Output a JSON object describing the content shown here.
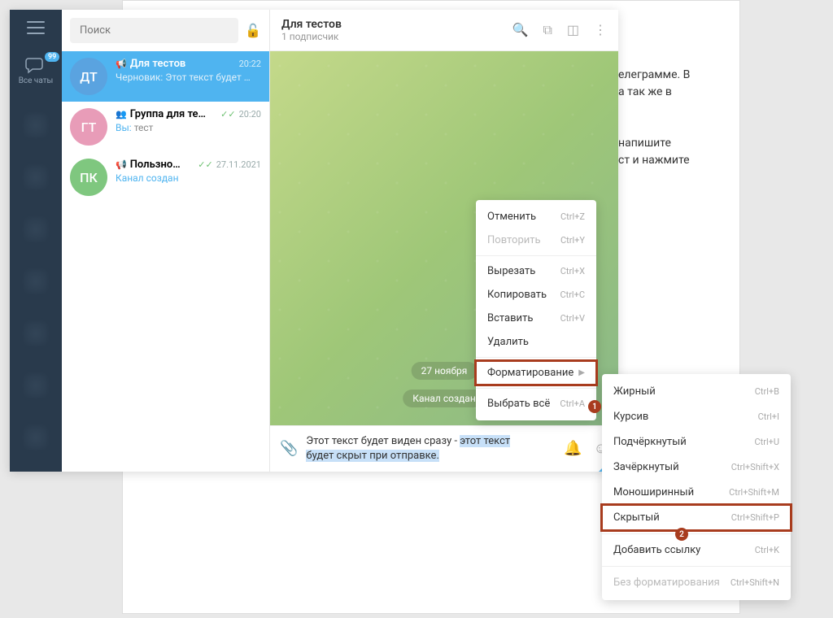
{
  "backdrop": {
    "line1": "елеграмме. В",
    "line2": "а так же в",
    "line3": "напишите",
    "line4": "ст и нажмите"
  },
  "rail": {
    "all_chats": "Все чаты",
    "badge": "99"
  },
  "search": {
    "placeholder": "Поиск"
  },
  "chats": [
    {
      "avatar": "ДТ",
      "name": "Для тестов",
      "time": "20:22",
      "prefix": "Черновик:",
      "preview": "Этот текст будет …"
    },
    {
      "avatar": "ГТ",
      "name": "Группа для те…",
      "time": "20:20",
      "you": "Вы:",
      "preview": "тест"
    },
    {
      "avatar": "ПК",
      "name": "Пользно…",
      "time": "27.11.2021",
      "preview": "Канал создан"
    }
  ],
  "header": {
    "title": "Для тестов",
    "sub": "1 подписчик"
  },
  "chat": {
    "date": "27 ноября",
    "service": "Канал создан"
  },
  "input": {
    "text1": "Этот текст будет виден сразу - ",
    "text2": "этот текст",
    "text3": "будет скрыт при отправке."
  },
  "menu1": {
    "undo": "Отменить",
    "undo_sc": "Ctrl+Z",
    "redo": "Повторить",
    "redo_sc": "Ctrl+Y",
    "cut": "Вырезать",
    "cut_sc": "Ctrl+X",
    "copy": "Копировать",
    "copy_sc": "Ctrl+C",
    "paste": "Вставить",
    "paste_sc": "Ctrl+V",
    "delete": "Удалить",
    "format": "Форматирование",
    "selectall": "Выбрать всё",
    "selectall_sc": "Ctrl+A"
  },
  "menu2": {
    "bold": "Жирный",
    "bold_sc": "Ctrl+B",
    "italic": "Курсив",
    "italic_sc": "Ctrl+I",
    "underline": "Подчёркнутый",
    "underline_sc": "Ctrl+U",
    "strike": "Зачёркнутый",
    "strike_sc": "Ctrl+Shift+X",
    "mono": "Моноширинный",
    "mono_sc": "Ctrl+Shift+M",
    "spoiler": "Скрытый",
    "spoiler_sc": "Ctrl+Shift+P",
    "link": "Добавить ссылку",
    "link_sc": "Ctrl+K",
    "clear": "Без форматирования",
    "clear_sc": "Ctrl+Shift+N"
  },
  "callouts": {
    "one": "1",
    "two": "2"
  }
}
